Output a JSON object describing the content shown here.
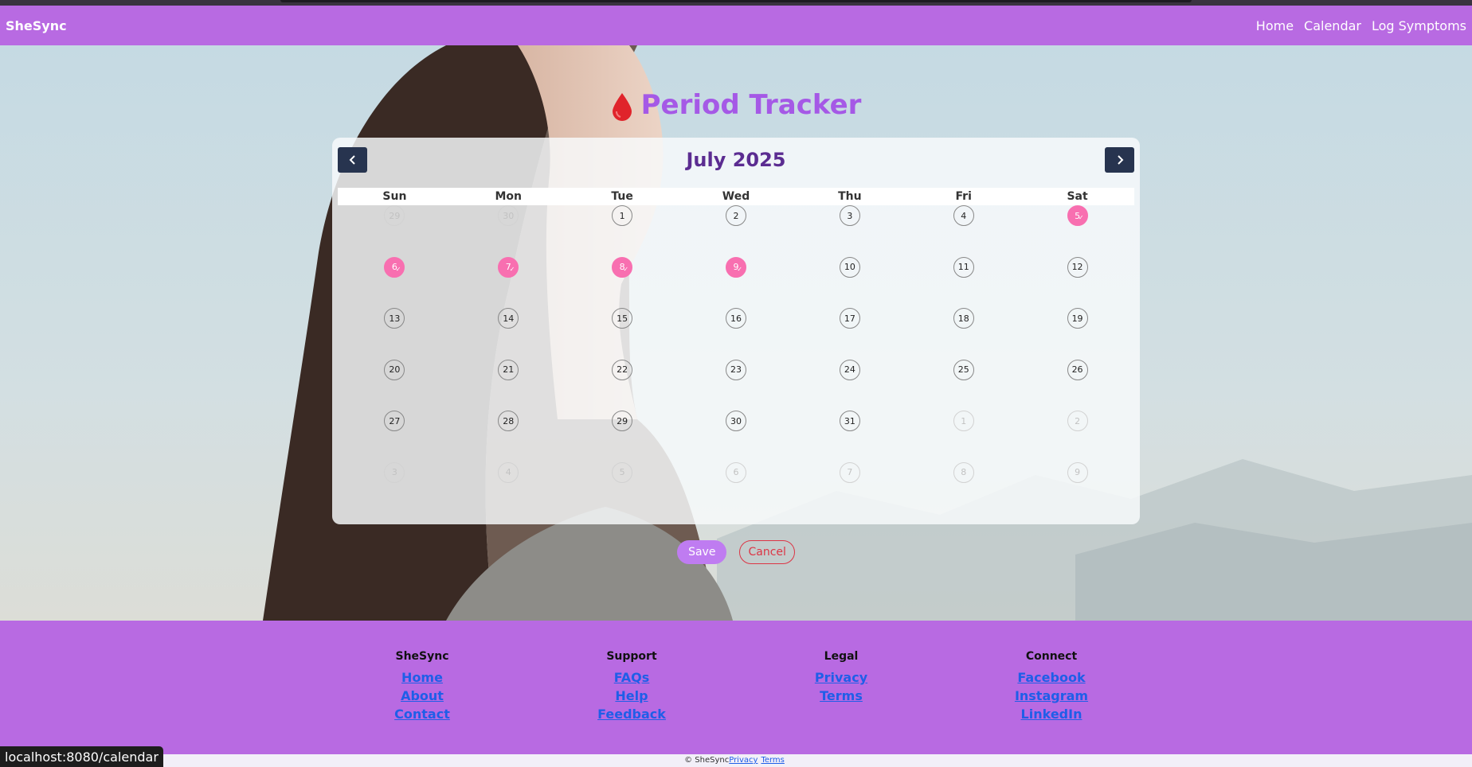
{
  "navbar": {
    "brand": "SheSync",
    "links": [
      "Home",
      "Calendar",
      "Log Symptoms"
    ]
  },
  "page": {
    "title": "Period Tracker",
    "icon": "blood-drop-icon"
  },
  "calendar": {
    "month_label": "July 2025",
    "prev_icon": "chevron-left-icon",
    "next_icon": "chevron-right-icon",
    "weekdays": [
      "Sun",
      "Mon",
      "Tue",
      "Wed",
      "Thu",
      "Fri",
      "Sat"
    ],
    "days": [
      {
        "n": "29",
        "other": true
      },
      {
        "n": "30",
        "other": true
      },
      {
        "n": "1"
      },
      {
        "n": "2"
      },
      {
        "n": "3"
      },
      {
        "n": "4"
      },
      {
        "n": "5",
        "period": true
      },
      {
        "n": "6",
        "period": true
      },
      {
        "n": "7",
        "period": true
      },
      {
        "n": "8",
        "period": true
      },
      {
        "n": "9",
        "period": true
      },
      {
        "n": "10"
      },
      {
        "n": "11"
      },
      {
        "n": "12"
      },
      {
        "n": "13"
      },
      {
        "n": "14"
      },
      {
        "n": "15"
      },
      {
        "n": "16"
      },
      {
        "n": "17"
      },
      {
        "n": "18"
      },
      {
        "n": "19"
      },
      {
        "n": "20"
      },
      {
        "n": "21"
      },
      {
        "n": "22"
      },
      {
        "n": "23"
      },
      {
        "n": "24"
      },
      {
        "n": "25"
      },
      {
        "n": "26"
      },
      {
        "n": "27"
      },
      {
        "n": "28"
      },
      {
        "n": "29"
      },
      {
        "n": "30"
      },
      {
        "n": "31"
      },
      {
        "n": "1",
        "other": true
      },
      {
        "n": "2",
        "other": true
      },
      {
        "n": "3",
        "other": true
      },
      {
        "n": "4",
        "other": true
      },
      {
        "n": "5",
        "other": true
      },
      {
        "n": "6",
        "other": true
      },
      {
        "n": "7",
        "other": true
      },
      {
        "n": "8",
        "other": true
      },
      {
        "n": "9",
        "other": true
      }
    ],
    "period_color": "#f86fb0"
  },
  "actions": {
    "save": "Save",
    "cancel": "Cancel"
  },
  "footer": {
    "columns": [
      {
        "heading": "SheSync",
        "links": [
          "Home",
          "About",
          "Contact"
        ]
      },
      {
        "heading": "Support",
        "links": [
          "FAQs",
          "Help",
          "Feedback"
        ]
      },
      {
        "heading": "Legal",
        "links": [
          "Privacy",
          "Terms"
        ]
      },
      {
        "heading": "Connect",
        "links": [
          "Facebook",
          "Instagram",
          "LinkedIn"
        ]
      }
    ],
    "copyright": "© SheSync",
    "bottom_links": [
      "Privacy",
      "Terms"
    ]
  },
  "status_url": "localhost:8080/calendar",
  "colors": {
    "brand_purple": "#b86ae2",
    "title_purple": "#a559e6",
    "month_purple": "#5b2c91",
    "nav_button": "#27344f",
    "save_button": "#bf7cf1",
    "cancel_red": "#dc3545"
  }
}
